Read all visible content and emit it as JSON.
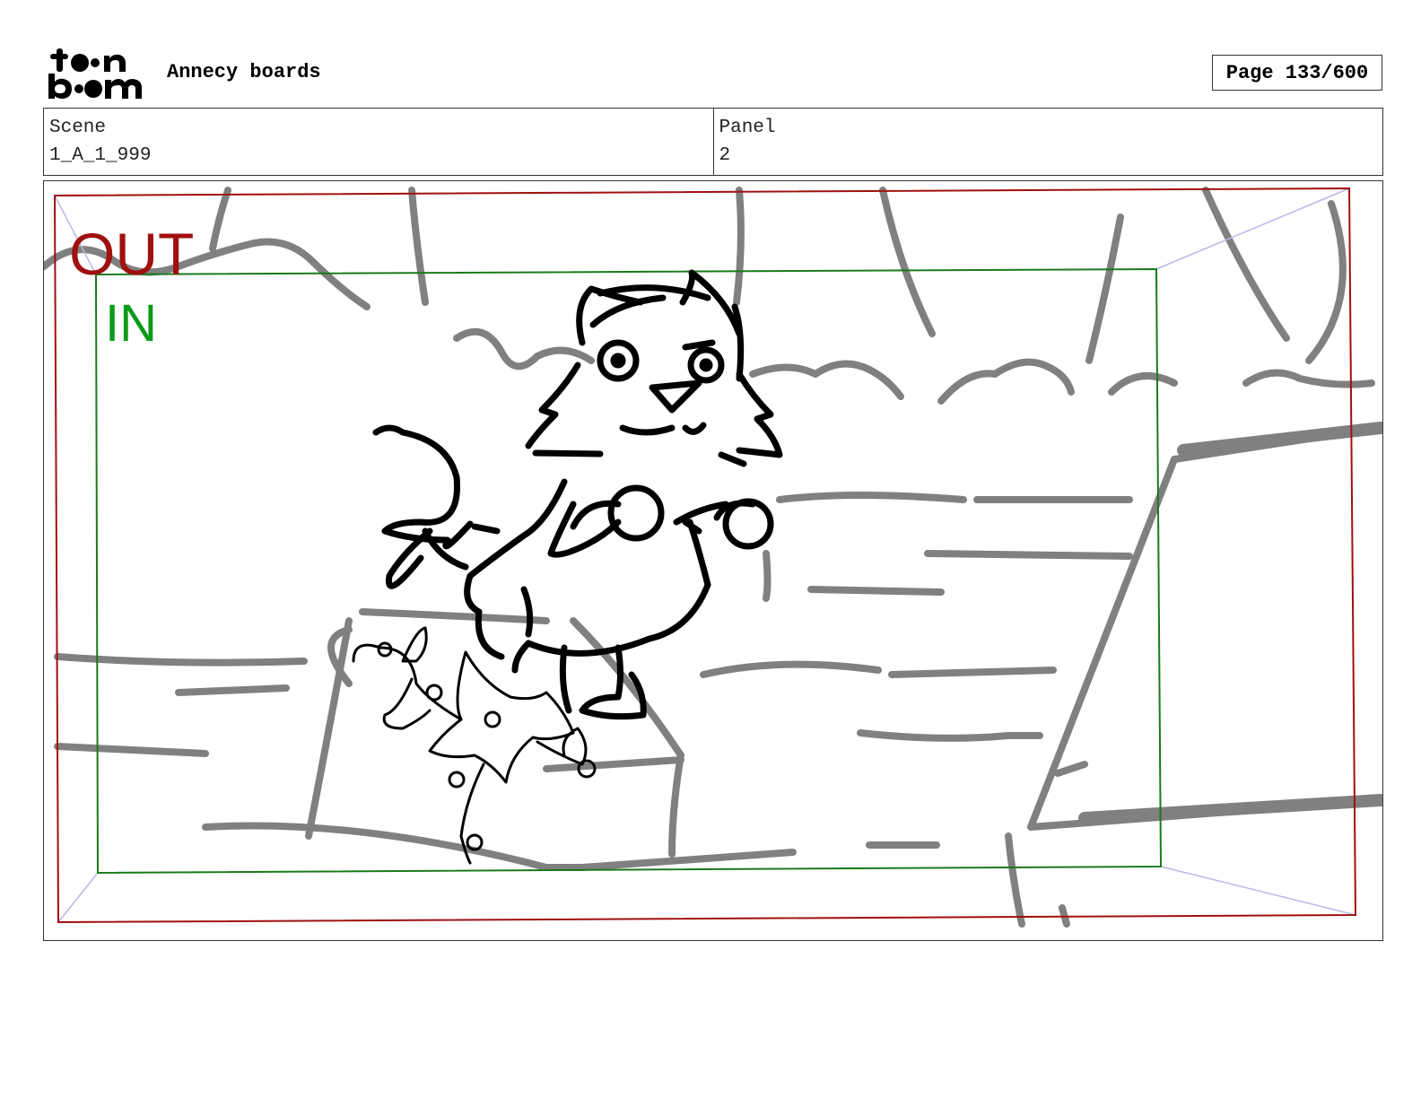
{
  "header": {
    "project_title": "Annecy boards",
    "page_label": "Page 133/600"
  },
  "info": {
    "scene_label": "Scene",
    "scene_value": "1_A_1_999",
    "panel_label": "Panel",
    "panel_value": "2"
  },
  "frame": {
    "out_label": "OUT",
    "in_label": "IN",
    "out_color": "#a01010",
    "in_color": "#0a9a1a"
  },
  "logo": {
    "icon": "toonboom-logo-icon",
    "text": "toon boom"
  }
}
